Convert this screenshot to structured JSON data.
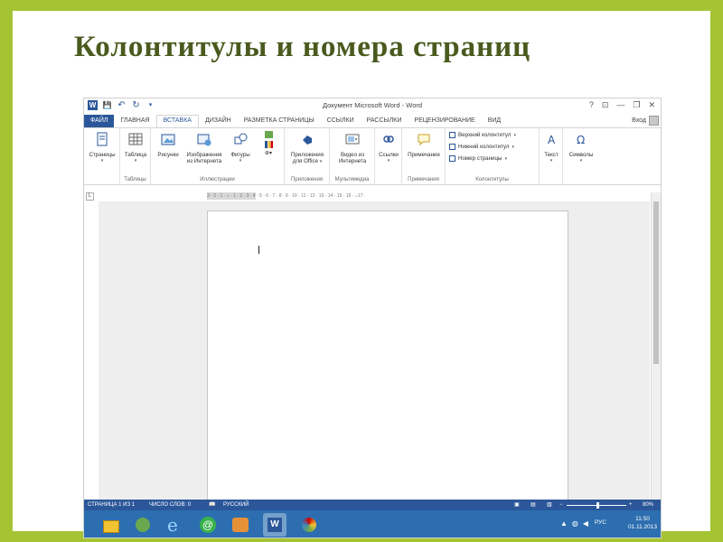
{
  "slide": {
    "title": "Колонтитулы и номера страниц"
  },
  "window": {
    "title": "Документ Microsoft Word - Word",
    "help": "?",
    "ribbon_opts": "⊡",
    "minimize": "—",
    "restore": "❐",
    "close": "✕"
  },
  "qat": {
    "save": "💾",
    "undo": "↶",
    "redo": "↻",
    "customize": "▾",
    "word": "W"
  },
  "tabs": [
    "ФАЙЛ",
    "ГЛАВНАЯ",
    "ВСТАВКА",
    "ДИЗАЙН",
    "РАЗМЕТКА СТРАНИЦЫ",
    "ССЫЛКИ",
    "РАССЫЛКИ",
    "РЕЦЕНЗИРОВАНИЕ",
    "ВИД"
  ],
  "signin": "Вход",
  "ribbon": {
    "pages": "Страницы",
    "table": "Таблица",
    "tables_group": "Таблицы",
    "pictures": "Рисунки",
    "online_pictures_1": "Изображения",
    "online_pictures_2": "из Интернета",
    "shapes": "Фигуры",
    "illustrations_group": "Иллюстрации",
    "apps_1": "Приложения",
    "apps_2": "для Office",
    "apps_group": "Приложения",
    "video_1": "Видео из",
    "video_2": "Интернета",
    "media_group": "Мультимедиа",
    "links": "Ссылки",
    "comment": "Примечание",
    "comments_group": "Примечания",
    "header": "Верхний колонтитул",
    "footer": "Нижний колонтитул",
    "page_number": "Номер страницы",
    "hf_group": "Колонтитулы",
    "text": "Текст",
    "symbols": "Символы"
  },
  "ruler": {
    "ticks": "3 · 2 · 1 · ⌂ · 1 · 2 · 3 · 4 · 5 · 6 · 7 · 8 · 9 · 10 · 11 · 12 · 13 · 14 · 15 · 16 · ⌂17 ·",
    "corner": "L"
  },
  "status": {
    "page": "СТРАНИЦА 1 ИЗ 1",
    "words": "ЧИСЛО СЛОВ: 0",
    "lang": "РУССКИЙ",
    "zoom": "80%",
    "minus": "−",
    "plus": "+"
  },
  "taskbar": {
    "lang": "РУС",
    "time": "11:50",
    "date": "01.11.2013"
  },
  "colors": {
    "slide_bg": "#a5c434",
    "title": "#4a5a1e",
    "word_blue": "#2b579a",
    "taskbar": "#2c6eb0"
  }
}
